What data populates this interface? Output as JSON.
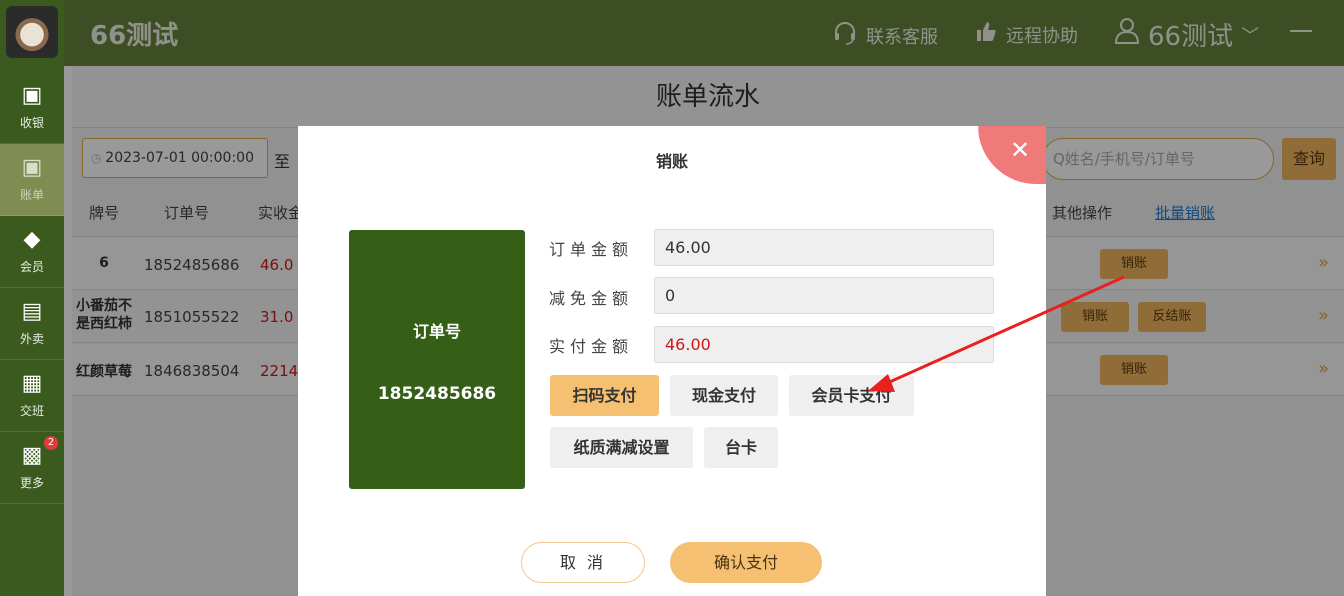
{
  "header": {
    "title": "66测试",
    "support": "联系客服",
    "remote": "远程协助",
    "user": "66测试"
  },
  "sidebar": {
    "items": [
      {
        "label": "收银",
        "icon": "cashier-icon"
      },
      {
        "label": "账单",
        "icon": "bill-icon"
      },
      {
        "label": "会员",
        "icon": "member-icon"
      },
      {
        "label": "外卖",
        "icon": "takeout-icon"
      },
      {
        "label": "交班",
        "icon": "shift-icon"
      },
      {
        "label": "更多",
        "icon": "more-icon",
        "badge": "2"
      }
    ]
  },
  "page": {
    "title": "账单流水",
    "date_from": "2023-07-01 00:00:00",
    "to_label": "至",
    "search_placeholder": "Q姓名/手机号/订单号",
    "query_label": "查询",
    "columns": {
      "table_no": "牌号",
      "order_no": "订单号",
      "paid": "实收金",
      "other_ops": "其他操作",
      "batch_settle": "批量销账"
    },
    "rows": [
      {
        "table": "6",
        "order": "1852485686",
        "amount": "46.0",
        "actions": [
          "销账"
        ]
      },
      {
        "table": "小番茄不是西红柿",
        "order": "1851055522",
        "amount": "31.0",
        "actions": [
          "销账",
          "反结账"
        ]
      },
      {
        "table": "红颜草莓",
        "order": "1846838504",
        "amount": "2214.",
        "actions": [
          "销账"
        ]
      }
    ]
  },
  "modal": {
    "title": "销账",
    "order_label": "订单号",
    "order_number": "1852485686",
    "fields": {
      "order_amount_label": "订单金额",
      "order_amount": "46.00",
      "discount_label": "减免金额",
      "discount": "0",
      "paid_label": "实付金额",
      "paid": "46.00"
    },
    "pay_methods": [
      "扫码支付",
      "现金支付",
      "会员卡支付",
      "纸质满减设置",
      "台卡"
    ],
    "selected_method": "扫码支付",
    "cancel": "取 消",
    "confirm": "确认支付"
  },
  "colors": {
    "sidebar": "#3a5a1e",
    "header": "#66833f",
    "accent": "#f5c072",
    "order_card": "#355e17",
    "close": "#f07a7a",
    "amount_red": "#d01818",
    "arrow": "#e8201e"
  }
}
